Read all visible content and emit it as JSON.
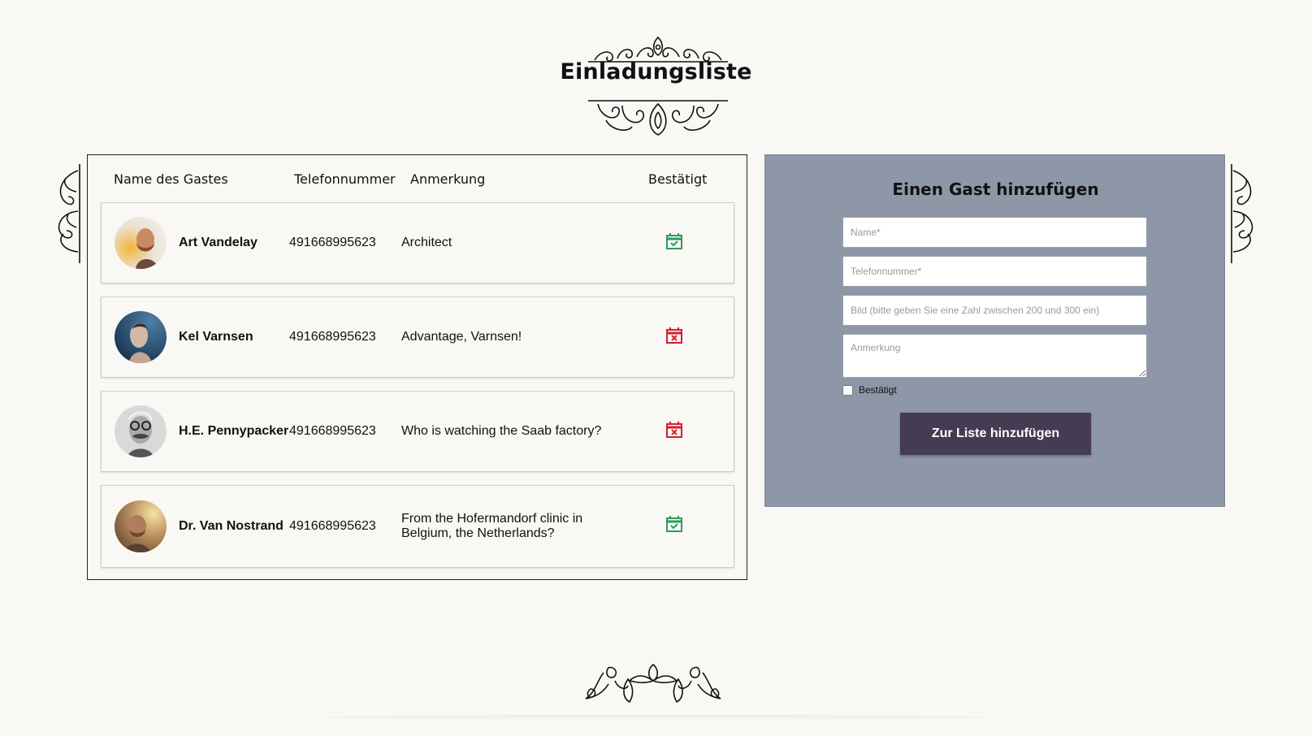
{
  "page": {
    "title": "Einladungsliste"
  },
  "table": {
    "headers": {
      "name": "Name des Gastes",
      "phone": "Telefonnummer",
      "note": "Anmerkung",
      "confirmed": "Bestätigt"
    },
    "guests": [
      {
        "name": "Art Vandelay",
        "phone": "491668995623",
        "note": "Architect",
        "confirmed": true,
        "status_icon": "calendar-check-icon"
      },
      {
        "name": "Kel Varnsen",
        "phone": "491668995623",
        "note": "Advantage, Varnsen!",
        "confirmed": false,
        "status_icon": "calendar-x-icon"
      },
      {
        "name": "H.E. Pennypacker",
        "phone": "491668995623",
        "note": "Who is watching the Saab factory?",
        "confirmed": false,
        "status_icon": "calendar-x-icon"
      },
      {
        "name": "Dr. Van Nostrand",
        "phone": "491668995623",
        "note": "From the Hofermandorf clinic in Belgium, the Netherlands?",
        "confirmed": true,
        "status_icon": "calendar-check-icon"
      }
    ]
  },
  "form": {
    "title": "Einen Gast hinzufügen",
    "name_placeholder": "Name*",
    "phone_placeholder": "Telefonnummer*",
    "image_placeholder": "Bild (bitte geben Sie eine Zahl zwischen 200 und 300 ein)",
    "note_placeholder": "Anmerkung",
    "confirmed_label": "Bestätigt",
    "submit_label": "Zur Liste hinzufügen"
  },
  "colors": {
    "background": "#f9f8f5",
    "form_panel": "#8d97a7",
    "submit_button": "#453b52",
    "confirmed": "#2e9a5a",
    "declined": "#d0202e"
  }
}
